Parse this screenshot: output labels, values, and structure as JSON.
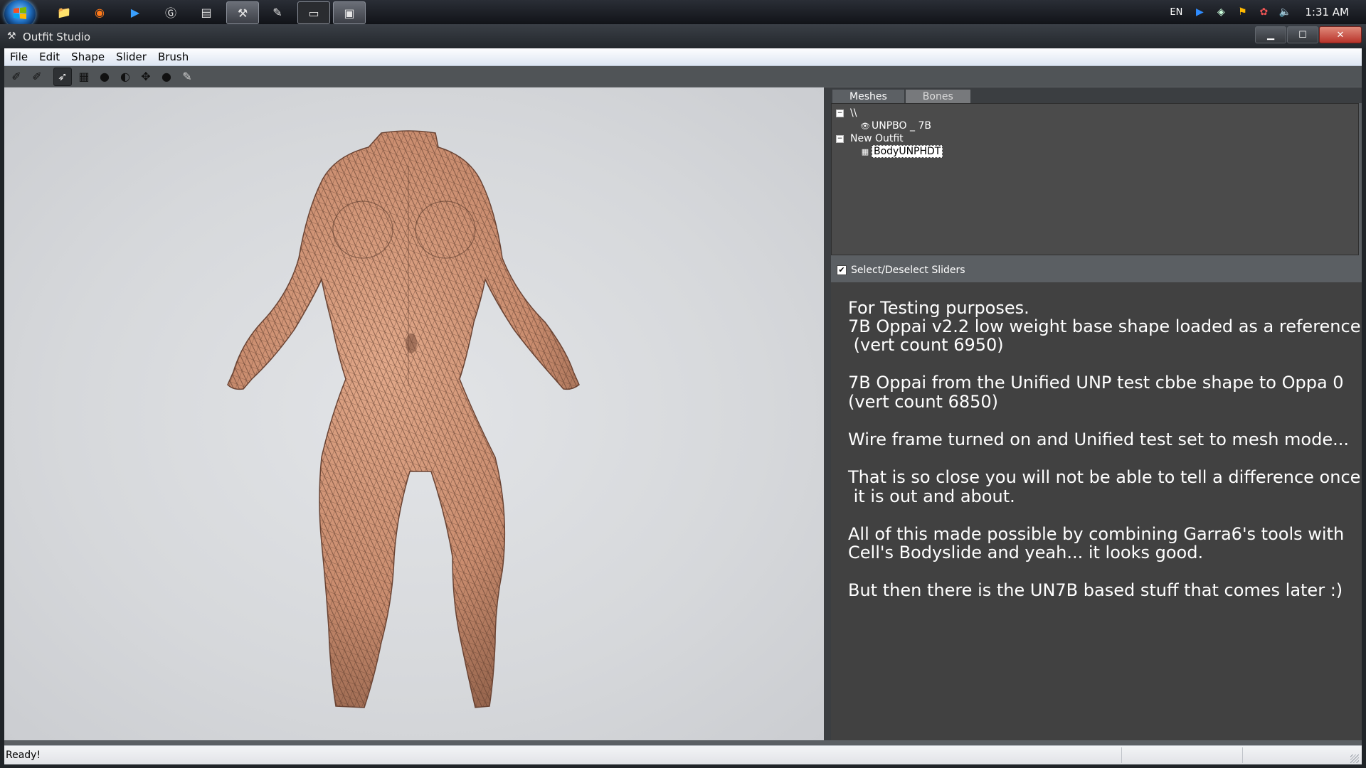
{
  "taskbar": {
    "apps": [
      {
        "name": "explorer",
        "icon": "📁"
      },
      {
        "name": "firefox",
        "icon": "◉"
      },
      {
        "name": "media-player",
        "icon": "▶"
      },
      {
        "name": "app-g",
        "icon": "Ⓖ"
      },
      {
        "name": "app-film",
        "icon": "▤"
      },
      {
        "name": "outfit-studio",
        "icon": "⚒",
        "active": true
      },
      {
        "name": "app-pen",
        "icon": "✎"
      },
      {
        "name": "app-console",
        "icon": "▭"
      },
      {
        "name": "app-window",
        "icon": "▣"
      }
    ],
    "language": "EN",
    "clock": "1:31 AM"
  },
  "window": {
    "title": "Outfit Studio",
    "controls": {
      "minimize": "▁",
      "maximize": "☐",
      "close": "✕"
    }
  },
  "menu": [
    "File",
    "Edit",
    "Shape",
    "Slider",
    "Brush"
  ],
  "toolbar": {
    "tools": [
      {
        "name": "tool-a",
        "icon": "✐"
      },
      {
        "name": "tool-b",
        "icon": "✐"
      },
      {
        "name": "select-brush",
        "icon": "➶",
        "selected": true
      },
      {
        "name": "mask-brush",
        "icon": "▦"
      },
      {
        "name": "inflate-brush",
        "icon": "●"
      },
      {
        "name": "deflate-brush",
        "icon": "◐"
      },
      {
        "name": "move-brush",
        "icon": "✥"
      },
      {
        "name": "smooth-brush",
        "icon": "●"
      },
      {
        "name": "pencil",
        "icon": "✎"
      }
    ]
  },
  "panel": {
    "tabs": [
      {
        "label": "Meshes",
        "active": true
      },
      {
        "label": "Bones",
        "active": false
      }
    ],
    "tree": {
      "root_label": "\\\\",
      "reference_shape": "UNPBO _ 7B",
      "outfit_label": "New Outfit",
      "outfit_shape": "BodyUNPHDT"
    },
    "sliders_toggle": {
      "label": "Select/Deselect Sliders",
      "checked": true
    }
  },
  "notes": [
    "For Testing purposes.",
    "7B Oppai v2.2 low weight base shape loaded as a reference",
    " (vert count 6950)",
    "7B Oppai from the Unified UNP test cbbe shape to Oppa 0",
    "(vert count 6850)",
    "Wire frame turned on and Unified test set to mesh mode...",
    "That is so close you will not be able to tell a difference once",
    " it is out and about.",
    "All of this made possible by combining Garra6's tools with",
    "Cell's Bodyslide and yeah... it looks good.",
    "But then there is the UN7B based stuff that comes later :)"
  ],
  "status": "Ready!",
  "colors": {
    "mesh_fill": "#c98c6e",
    "mesh_wire": "#5a3a2c",
    "viewport_bg": "#d7d9dc"
  }
}
